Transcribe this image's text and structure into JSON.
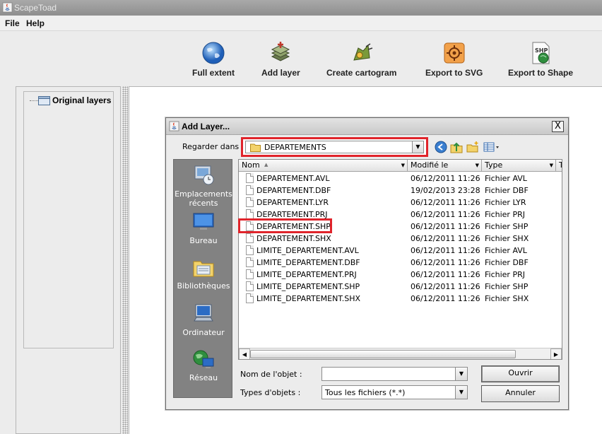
{
  "window": {
    "title": "ScapeToad"
  },
  "menu": {
    "file": "File",
    "help": "Help"
  },
  "toolbar": {
    "full_extent": "Full extent",
    "add_layer": "Add layer",
    "create_cartogram": "Create cartogram",
    "export_svg": "Export to SVG",
    "export_shape": "Export to Shape"
  },
  "layers": {
    "root": "Original layers"
  },
  "dialog": {
    "title": "Add Layer...",
    "close": "X",
    "look_in_label": "Regarder dans :",
    "look_in_value": "DEPARTEMENTS",
    "places": [
      "Emplacements récents",
      "Bureau",
      "Bibliothèques",
      "Ordinateur",
      "Réseau"
    ],
    "columns": {
      "name": "Nom",
      "modified": "Modifié le",
      "type": "Type",
      "extra": "T"
    },
    "files": [
      {
        "name": "DEPARTEMENT.AVL",
        "date": "06/12/2011 11:26",
        "type": "Fichier AVL"
      },
      {
        "name": "DEPARTEMENT.DBF",
        "date": "19/02/2013 23:28",
        "type": "Fichier DBF"
      },
      {
        "name": "DEPARTEMENT.LYR",
        "date": "06/12/2011 11:26",
        "type": "Fichier LYR"
      },
      {
        "name": "DEPARTEMENT.PRJ",
        "date": "06/12/2011 11:26",
        "type": "Fichier PRJ"
      },
      {
        "name": "DEPARTEMENT.SHP",
        "date": "06/12/2011 11:26",
        "type": "Fichier SHP"
      },
      {
        "name": "DEPARTEMENT.SHX",
        "date": "06/12/2011 11:26",
        "type": "Fichier SHX"
      },
      {
        "name": "LIMITE_DEPARTEMENT.AVL",
        "date": "06/12/2011 11:26",
        "type": "Fichier AVL"
      },
      {
        "name": "LIMITE_DEPARTEMENT.DBF",
        "date": "06/12/2011 11:26",
        "type": "Fichier DBF"
      },
      {
        "name": "LIMITE_DEPARTEMENT.PRJ",
        "date": "06/12/2011 11:26",
        "type": "Fichier PRJ"
      },
      {
        "name": "LIMITE_DEPARTEMENT.SHP",
        "date": "06/12/2011 11:26",
        "type": "Fichier SHP"
      },
      {
        "name": "LIMITE_DEPARTEMENT.SHX",
        "date": "06/12/2011 11:26",
        "type": "Fichier SHX"
      }
    ],
    "filename_label": "Nom de l'objet :",
    "filename_value": "",
    "filetype_label": "Types d'objets :",
    "filetype_value": "Tous les fichiers (*.*)",
    "open_button": "Ouvrir",
    "cancel_button": "Annuler"
  }
}
